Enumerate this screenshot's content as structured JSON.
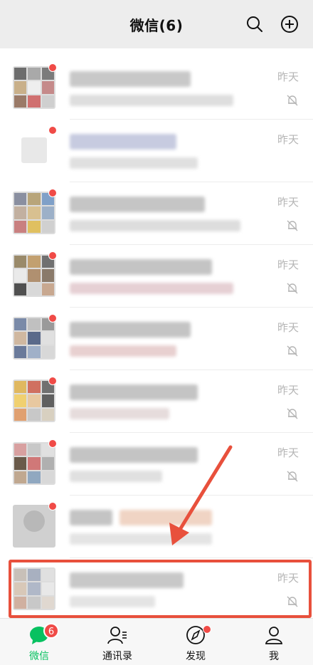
{
  "header": {
    "title": "微信(6)"
  },
  "chats": [
    {
      "time": "昨天",
      "muted": true
    },
    {
      "time": "昨天",
      "muted": false
    },
    {
      "time": "昨天",
      "muted": true
    },
    {
      "time": "昨天",
      "muted": true
    },
    {
      "time": "昨天",
      "muted": true
    },
    {
      "time": "昨天",
      "muted": true
    },
    {
      "time": "昨天",
      "muted": true
    },
    {
      "time": "",
      "muted": false
    },
    {
      "time": "昨天",
      "muted": true
    }
  ],
  "tabs": [
    {
      "label": "微信",
      "badge": "6"
    },
    {
      "label": "通讯录"
    },
    {
      "label": "发现"
    },
    {
      "label": "我"
    }
  ],
  "colors": {
    "accent": "#07c160",
    "badge": "#f04b47",
    "highlight": "#e8503c"
  }
}
